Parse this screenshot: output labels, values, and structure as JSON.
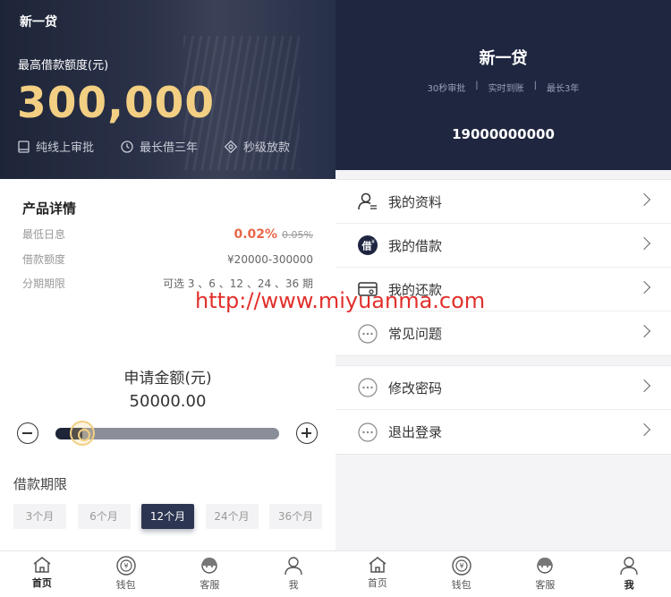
{
  "loan_home": {
    "app_name": "新一贷",
    "limit_label": "最高借款额度(元)",
    "limit_amount": "300,000",
    "features": [
      "纯线上审批",
      "最长借三年",
      "秒级放款"
    ],
    "details_title": "产品详情",
    "details": [
      {
        "label": "最低日息",
        "value": "0.02%",
        "old_value": "0.05%"
      },
      {
        "label": "借款额度",
        "value": "¥20000-300000"
      },
      {
        "label": "分期期限",
        "value": "可选 3 、6 、12 、24 、36 期"
      }
    ],
    "watermark": "http://www.miyuanma.com",
    "apply_label": "申请金额(元)",
    "apply_value": "50000.00",
    "slider_fraction": 0.12,
    "term_label": "借款期限",
    "terms": [
      "3个月",
      "6个月",
      "12个月",
      "24个月",
      "36个月"
    ],
    "selected_term": "12个月"
  },
  "profile": {
    "app_name": "新一贷",
    "tags": [
      "30秒审批",
      "|",
      "实时到账",
      "|",
      "最长3年"
    ],
    "phone": "19000000000",
    "menu_group_1": [
      "我的资料",
      "我的借款",
      "我的还款",
      "常见问题"
    ],
    "menu_group_2": [
      "修改密码",
      "退出登录"
    ]
  },
  "tabbar": {
    "items": [
      "首页",
      "钱包",
      "客服",
      "我"
    ]
  },
  "colors": {
    "hero_bg": "#1e2538",
    "gold": "#f2cf83",
    "rate_red": "#e8674a",
    "active_term": "#2c3551",
    "watermark": "#e1302c"
  },
  "icons": {
    "features": [
      "document-icon",
      "clock-icon",
      "eye-circle-icon"
    ],
    "tabs": [
      "home-icon",
      "wallet-icon",
      "customer-service-icon",
      "user-icon"
    ],
    "menu": [
      "profile-icon",
      "borrow-icon",
      "card-icon",
      "more-dots-icon",
      "more-dots-icon",
      "more-dots-icon"
    ]
  }
}
